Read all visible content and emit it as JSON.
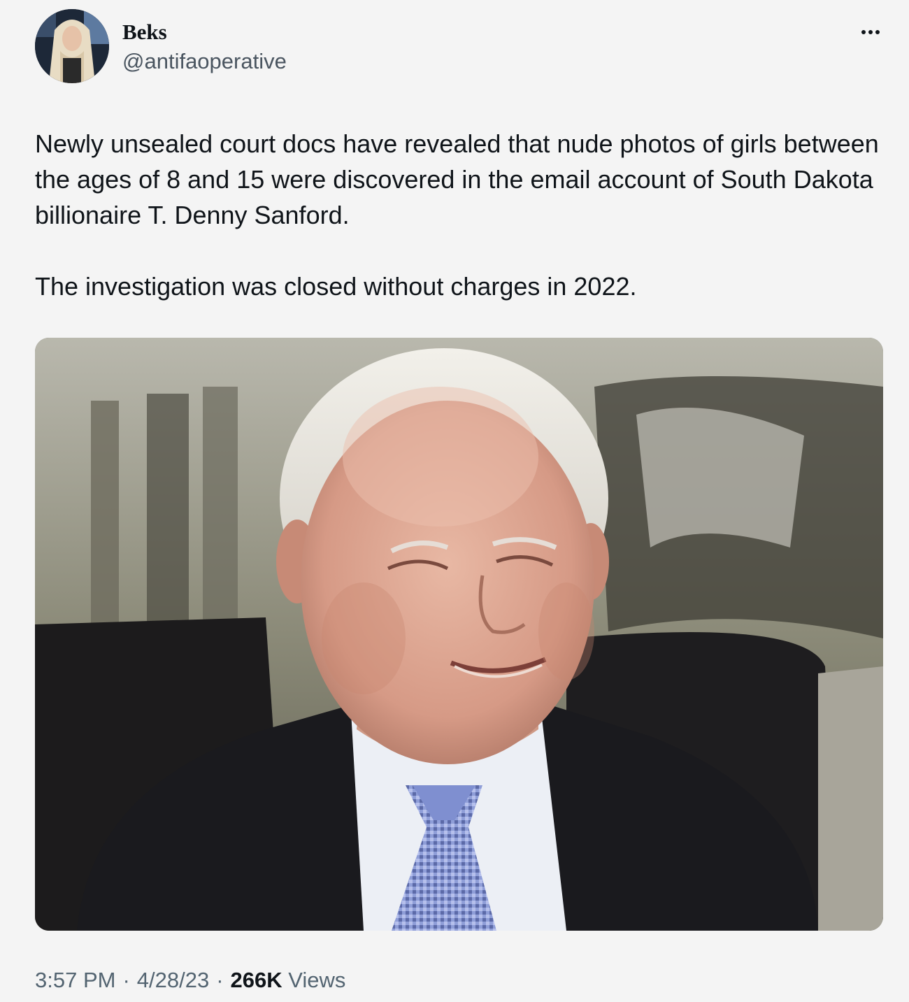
{
  "author": {
    "display_name": "Beks",
    "handle": "@antifaoperative"
  },
  "tweet": {
    "paragraphs": [
      "Newly unsealed court docs have revealed that nude photos of girls between the ages of 8 and 15 were discovered in the email account of South Dakota billionaire T. Denny Sanford.",
      "The investigation was closed without charges in 2022."
    ],
    "media_alt": "Photo of an elderly man in a suit and tie"
  },
  "meta": {
    "time": "3:57 PM",
    "separator": "·",
    "date": "4/28/23",
    "views_count": "266K",
    "views_label": "Views"
  },
  "icons": {
    "more": "more-horizontal-icon"
  },
  "colors": {
    "background": "#f4f4f4",
    "text_primary": "#0f1419",
    "text_secondary": "#536471"
  }
}
